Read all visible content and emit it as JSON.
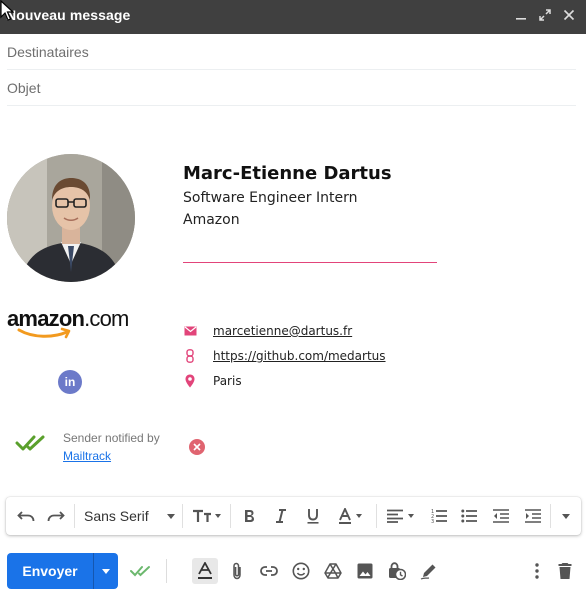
{
  "window": {
    "title": "Nouveau message",
    "controls": [
      "minimize-icon",
      "expand-icon",
      "close-icon"
    ]
  },
  "fields": {
    "to_placeholder": "Destinataires",
    "subject_placeholder": "Objet"
  },
  "signature": {
    "name": "Marc-Etienne Dartus",
    "role": "Software Engineer Intern",
    "company": "Amazon",
    "company_logo": "amazon.com",
    "email": "marcetienne@dartus.fr",
    "github": "https://github.com/medartus",
    "location": "Paris",
    "social": "in",
    "accent_color": "#e2447a"
  },
  "mailtrack": {
    "notice": "Sender notified by",
    "link": "Mailtrack"
  },
  "formatting": {
    "font": "Sans Serif",
    "tools": [
      "undo-icon",
      "redo-icon",
      "text-size-icon",
      "bold-icon",
      "italic-icon",
      "underline-icon",
      "text-color-icon",
      "align-icon",
      "numbered-list-icon",
      "bulleted-list-icon",
      "indent-less-icon",
      "indent-more-icon",
      "more-formatting-icon"
    ]
  },
  "actions": {
    "send_label": "Envoyer",
    "send_color": "#1a73e8",
    "tools": [
      "mailtrack-icon",
      "formatting-options-icon",
      "attach-icon",
      "link-icon",
      "emoji-icon",
      "drive-icon",
      "photo-icon",
      "confidential-icon",
      "signature-icon",
      "more-options-icon",
      "discard-icon"
    ]
  }
}
